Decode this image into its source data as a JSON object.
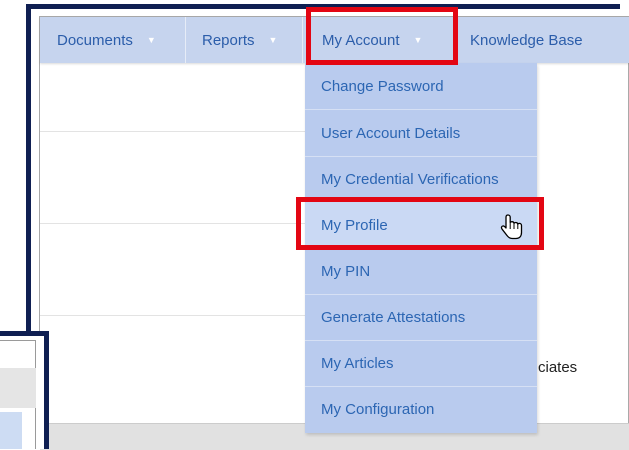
{
  "navbar": {
    "items": [
      {
        "label": "Documents"
      },
      {
        "label": "Reports"
      },
      {
        "label": "My Account"
      },
      {
        "label": "Knowledge Base"
      }
    ],
    "caret_icon": "caret-down-icon"
  },
  "dropdown": {
    "items": [
      {
        "label": "Change Password"
      },
      {
        "label": "User Account Details"
      },
      {
        "label": "My Credential Verifications"
      },
      {
        "label": "My Profile"
      },
      {
        "label": "My PIN"
      },
      {
        "label": "Generate Attestations"
      },
      {
        "label": "My Articles"
      },
      {
        "label": "My Configuration"
      }
    ],
    "hovered_item": "My Profile"
  },
  "background": {
    "partial_text": "ciates"
  },
  "annotations": {
    "highlight_color": "#e30613",
    "frame_color": "#0f1f52",
    "cursor_icon": "hand-pointer-icon"
  },
  "theme": {
    "navbar_bg": "#c6d4ee",
    "dropdown_bg": "#b9cbee",
    "link_color": "#2b5daa"
  }
}
